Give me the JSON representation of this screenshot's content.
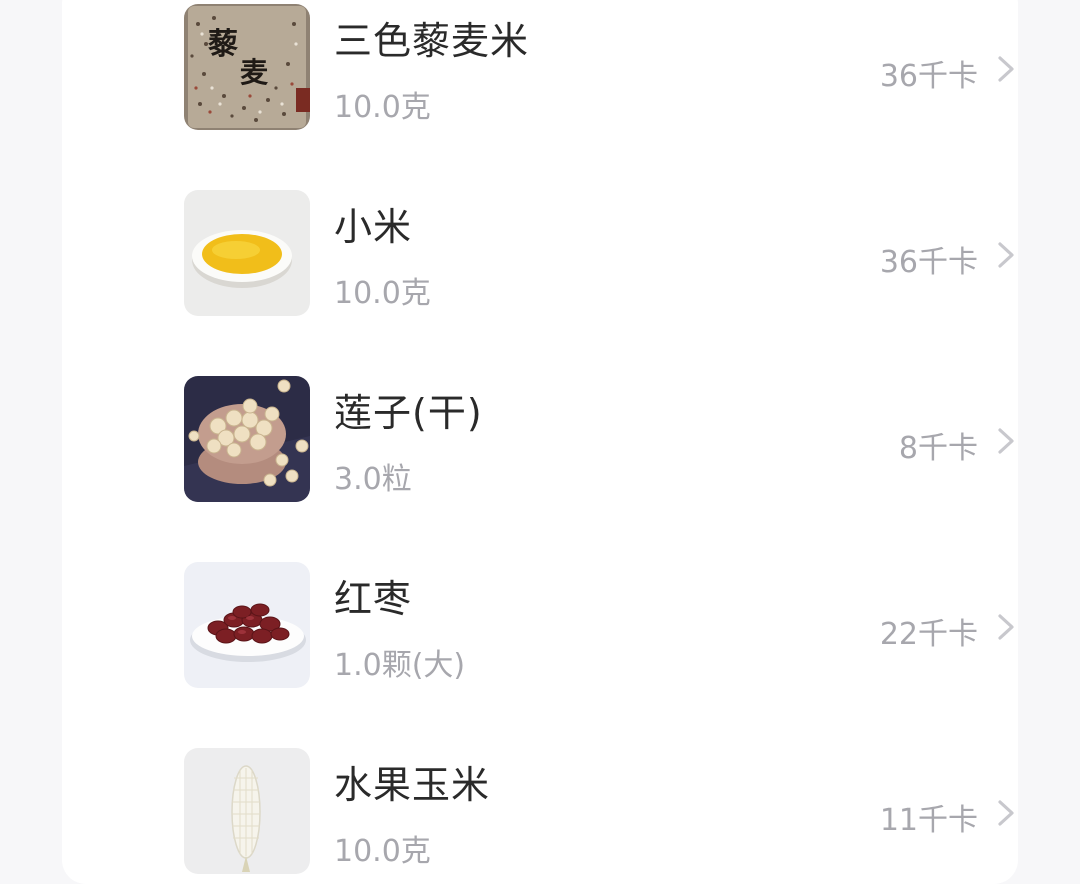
{
  "food_list": [
    {
      "name": "三色藜麦米",
      "amount": "10.0克",
      "calories": "36千卡",
      "image": "quinoa-bag-photo",
      "image_text": [
        "藜",
        "麦"
      ]
    },
    {
      "name": "小米",
      "amount": "10.0克",
      "calories": "36千卡",
      "image": "millet-plate-photo"
    },
    {
      "name": "莲子(干)",
      "amount": "3.0粒",
      "calories": "8千卡",
      "image": "lotus-seeds-bowl-photo"
    },
    {
      "name": "红枣",
      "amount": "1.0颗(大)",
      "calories": "22千卡",
      "image": "red-dates-plate-photo"
    },
    {
      "name": "水果玉米",
      "amount": "10.0克",
      "calories": "11千卡",
      "image": "corn-photo"
    }
  ],
  "colors": {
    "background": "#f7f7f9",
    "card": "#ffffff",
    "name_text": "#2a2a2a",
    "secondary_text": "#a7a7ad"
  },
  "icons": {
    "row_arrow": "chevron-right-icon"
  }
}
